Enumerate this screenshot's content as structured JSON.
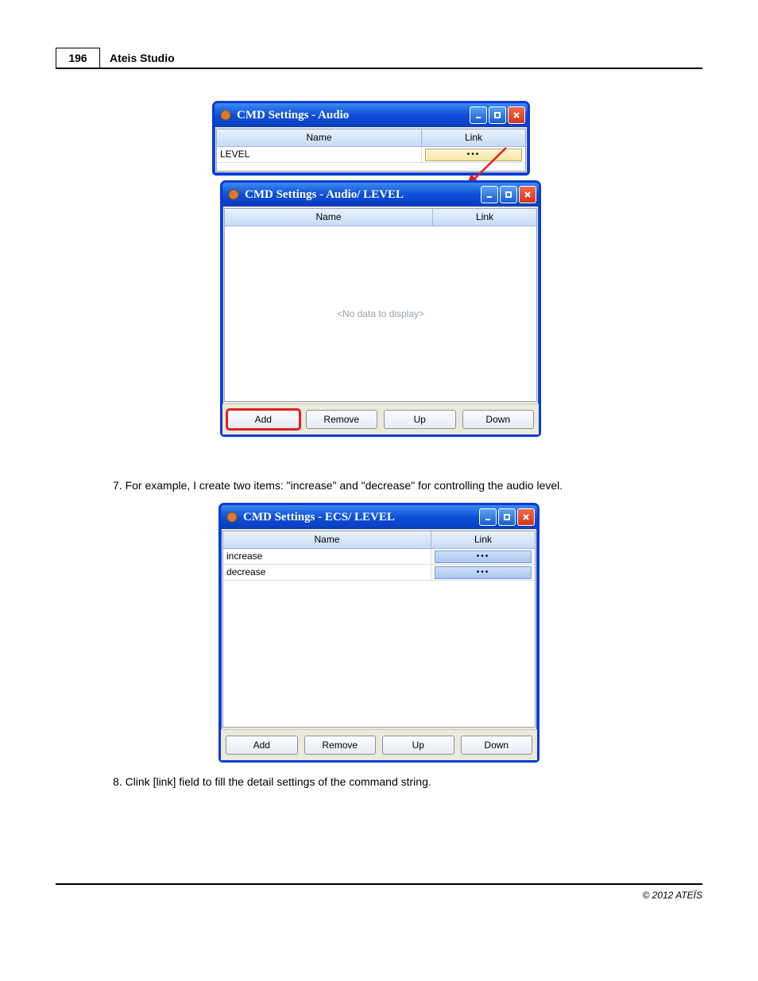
{
  "header": {
    "page_number": "196",
    "title": "Ateis Studio"
  },
  "figure1": {
    "back_window": {
      "title": "CMD Settings - Audio",
      "col_name": "Name",
      "col_link": "Link",
      "rows": [
        {
          "name": "LEVEL",
          "link": "•••"
        }
      ]
    },
    "front_window": {
      "title": "CMD Settings - Audio/ LEVEL",
      "col_name": "Name",
      "col_link": "Link",
      "empty_text": "<No data to display>",
      "buttons": {
        "add": "Add",
        "remove": "Remove",
        "up": "Up",
        "down": "Down"
      }
    }
  },
  "step7": "7. For example, I create two items: \"increase\" and \"decrease\" for controlling the audio level.",
  "figure2": {
    "window": {
      "title": "CMD Settings - ECS/ LEVEL",
      "col_name": "Name",
      "col_link": "Link",
      "rows": [
        {
          "name": "increase",
          "link": "•••"
        },
        {
          "name": "decrease",
          "link": "•••"
        }
      ],
      "buttons": {
        "add": "Add",
        "remove": "Remove",
        "up": "Up",
        "down": "Down"
      }
    }
  },
  "step8": "8. Clink [link] field to fill the detail settings of the command string.",
  "footer": "© 2012 ATEÏS"
}
